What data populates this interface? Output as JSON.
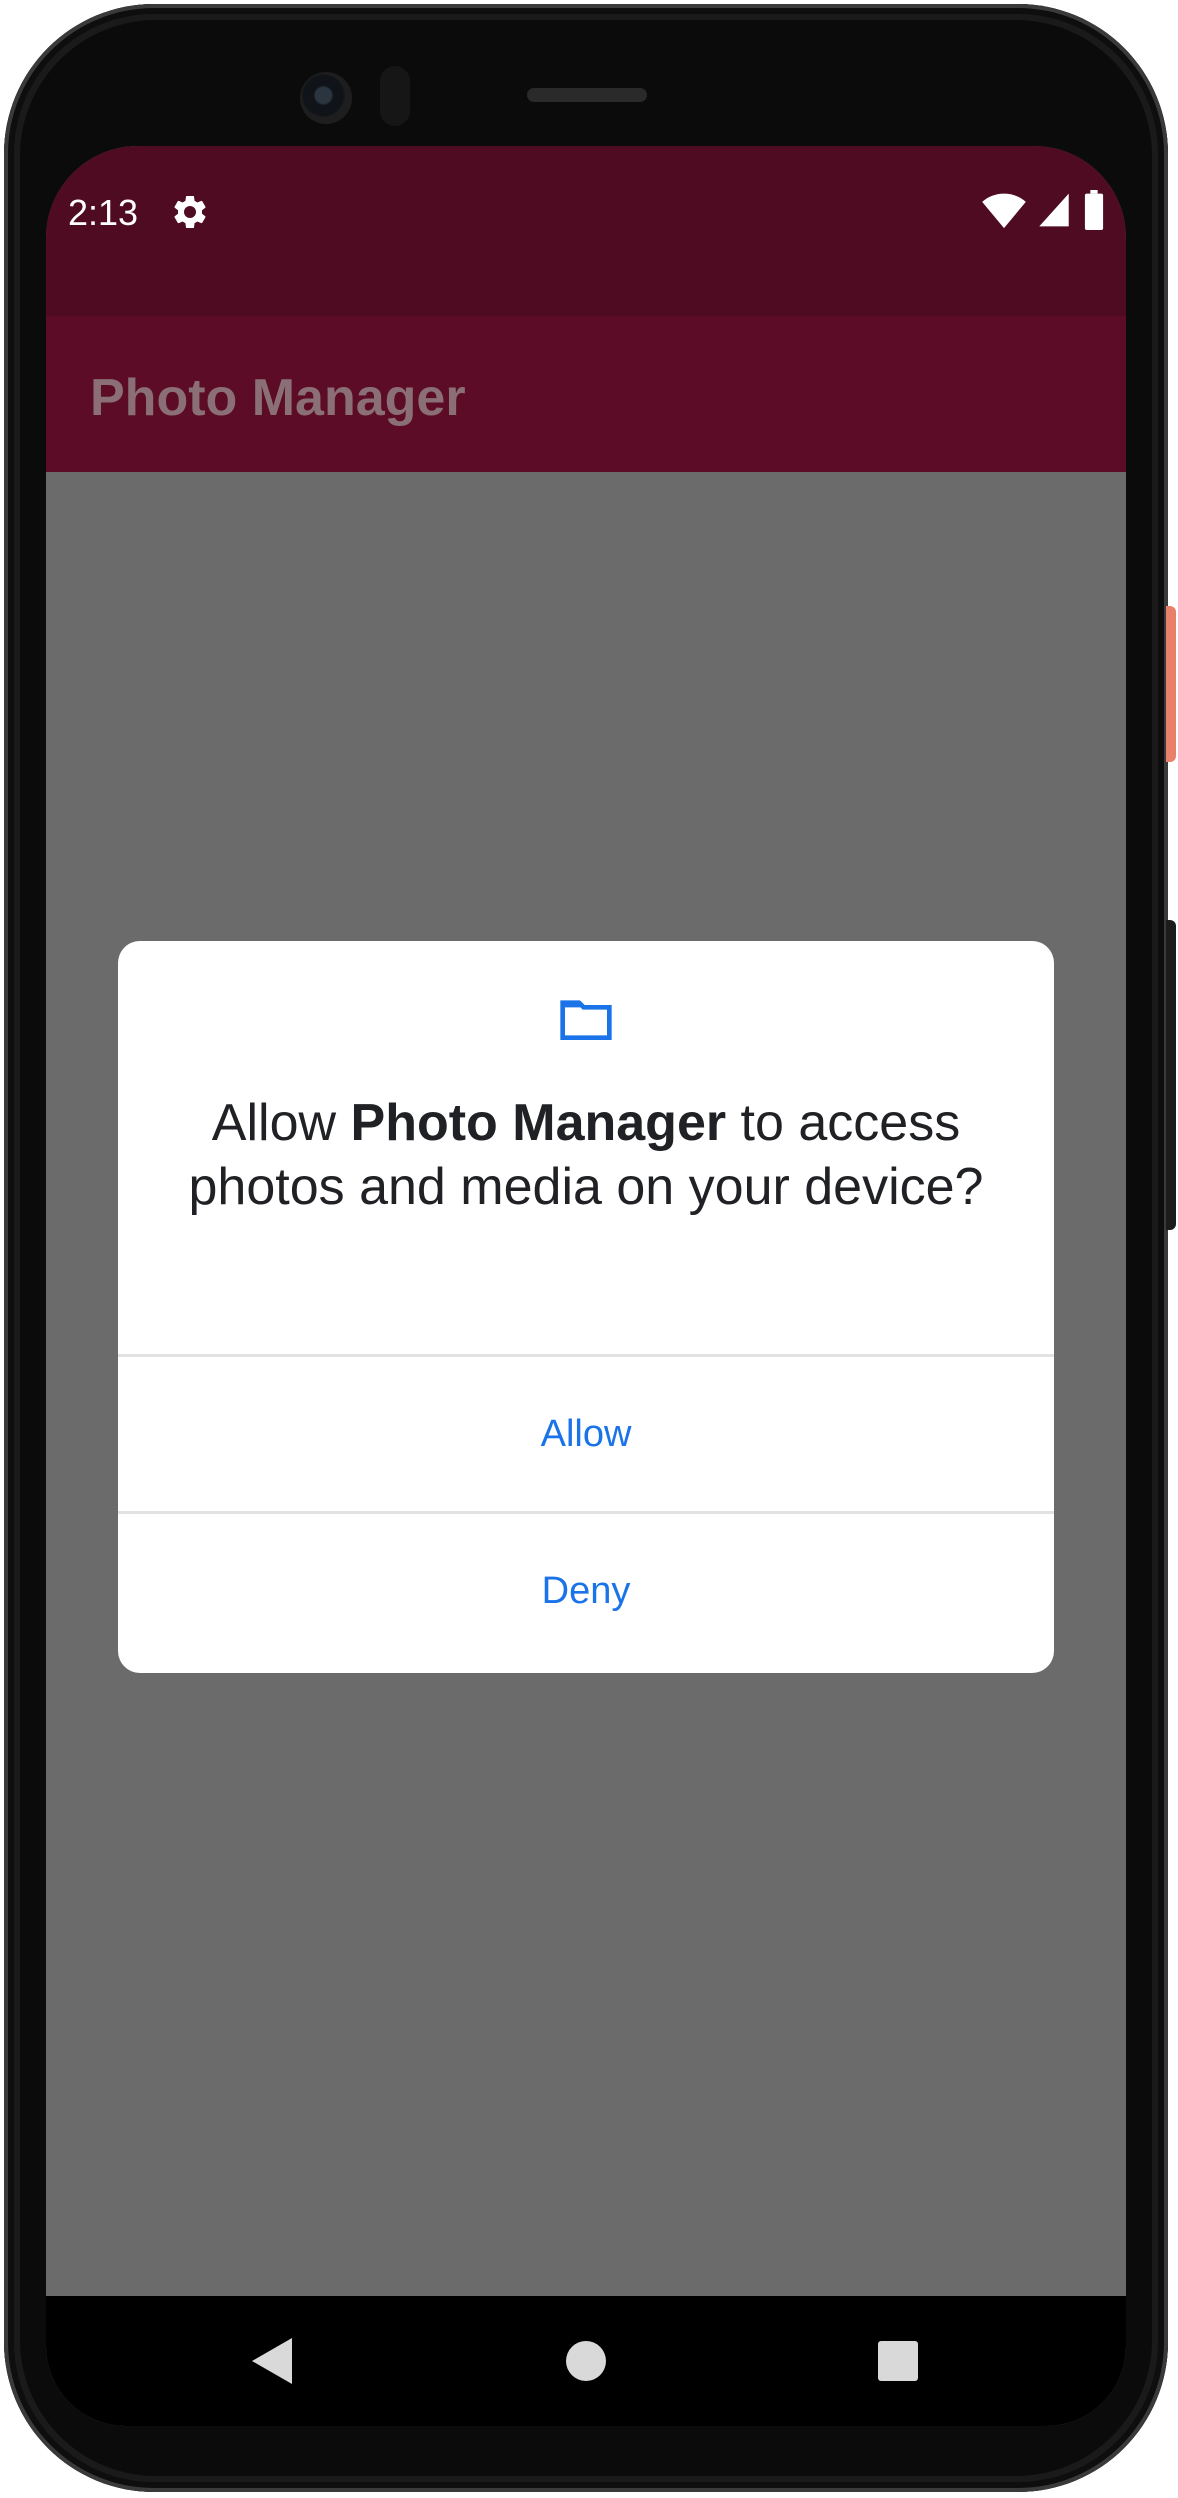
{
  "status_bar": {
    "time": "2:13",
    "icons": [
      "gear-icon",
      "wifi-icon",
      "signal-icon",
      "battery-icon"
    ]
  },
  "app_bar": {
    "title": "Photo Manager"
  },
  "dialog": {
    "icon": "folder-icon",
    "message_prefix": "Allow ",
    "message_app": "Photo Manager",
    "message_suffix": " to access photos and media on your device?",
    "allow_label": "Allow",
    "deny_label": "Deny"
  },
  "nav_bar": {
    "icons": [
      "back-icon",
      "home-icon",
      "recents-icon"
    ]
  },
  "colors": {
    "status_bar": "#4f0b22",
    "app_bar": "#5d0c27",
    "scrim": "#6b6b6b",
    "accent": "#1a73e8"
  }
}
